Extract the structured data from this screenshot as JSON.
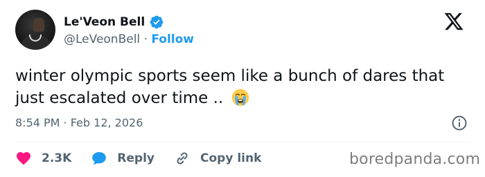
{
  "author": {
    "name": "Le'Veon Bell",
    "handle": "@LeVeonBell",
    "separator": "·",
    "follow_label": "Follow",
    "verified_color": "#1d9bf0"
  },
  "tweet": {
    "text": "winter olympic sports seem like a bunch of dares that just escalated over time ..",
    "emoji": "loudly-crying-face",
    "timestamp": "8:54 PM · Feb 12, 2026"
  },
  "actions": {
    "like_count": "2.3K",
    "reply_label": "Reply",
    "copy_link_label": "Copy link"
  },
  "watermark": "boredpanda.com",
  "icons": {
    "brand": "x-logo",
    "info": "info-icon",
    "like": "heart-icon",
    "reply": "reply-bubble-icon",
    "copy": "link-icon"
  },
  "colors": {
    "like": "#f91880",
    "reply": "#1d9bf0",
    "text": "#0f1419",
    "secondary": "#536471"
  }
}
